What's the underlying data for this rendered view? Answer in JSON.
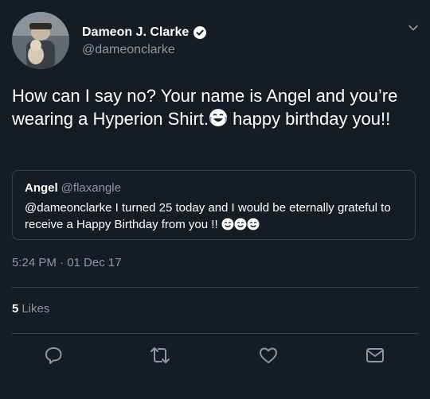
{
  "author": {
    "display_name": "Dameon J. Clarke",
    "handle": "@dameonclarke",
    "verified": true
  },
  "tweet": {
    "text_before_emoji": "How can I say no? Your name is Angel and you’re wearing a Hyperion Shirt.",
    "text_after_emoji": " happy birthday you!!",
    "emoji_icon": "face-with-tears-of-joy-icon"
  },
  "quoted_tweet": {
    "display_name": "Angel",
    "handle": "@flaxangle",
    "text": "@dameonclarke  I turned 25 today and I would be eternally grateful to receive a Happy Birthday from you !! ",
    "emoji_icons": [
      "smiling-face-icon",
      "smiling-face-icon",
      "smiling-face-icon"
    ]
  },
  "timestamp": "5:24 PM · 01 Dec 17",
  "likes": {
    "count": "5",
    "label": "Likes"
  },
  "actions": [
    "reply-icon",
    "retweet-icon",
    "like-icon",
    "direct-message-icon"
  ],
  "colors": {
    "background": "#141d26",
    "secondary_text": "#8899a6",
    "border": "#38444d",
    "verified": "#ffffff"
  }
}
